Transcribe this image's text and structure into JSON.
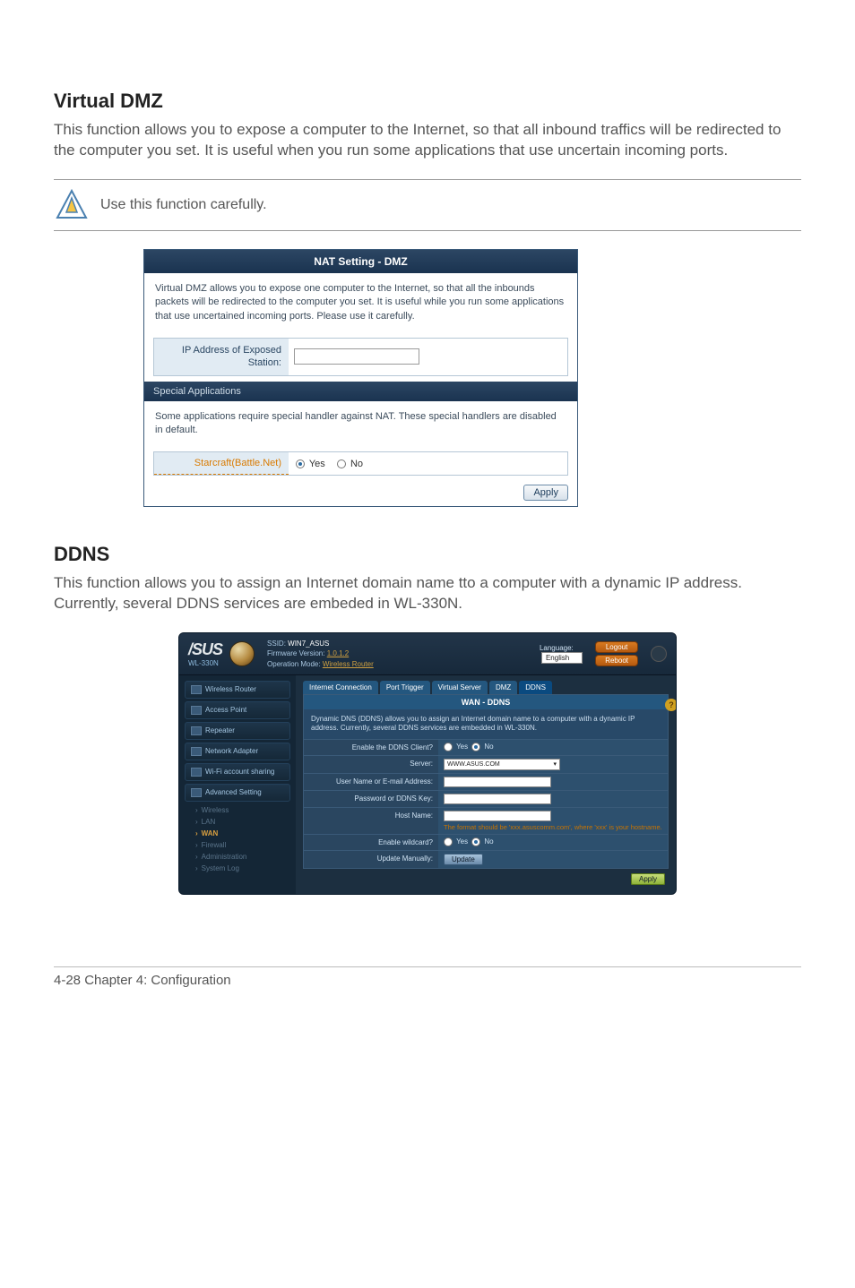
{
  "section1": {
    "heading": "Virtual DMZ",
    "desc": "This function allows you to expose a computer to the Internet, so that all inbound traffics will be redirected to the computer you set. It is useful when you run some applications that use uncertain incoming ports.",
    "note": "Use this function carefully."
  },
  "dmz": {
    "title": "NAT Setting - DMZ",
    "desc": "Virtual DMZ allows you to expose one computer to the Internet, so that all the inbounds packets will be redirected to the computer you set. It is useful while you run some applications that use uncertained incoming ports. Please use it carefully.",
    "ip_label": "IP Address of Exposed Station:",
    "ip_value": "",
    "special_header": "Special Applications",
    "special_desc": "Some applications require special handler against NAT. These special handlers are disabled in default.",
    "starcraft_label": "Starcraft(Battle.Net)",
    "yes_label": "Yes",
    "no_label": "No",
    "apply": "Apply"
  },
  "section2": {
    "heading": "DDNS",
    "desc": "This function allows you to assign an Internet domain name tto a computer with a dynamic IP address. Currently, several DDNS services are embeded in WL-330N."
  },
  "router": {
    "brand": "/SUS",
    "model": "WL-330N",
    "ssid_lbl": "SSID:",
    "ssid_val": "WIN7_ASUS",
    "fw_lbl": "Firmware Version:",
    "fw_val": "1.0.1.2",
    "mode_lbl": "Operation Mode:",
    "mode_val": "Wireless Router",
    "lang_lbl": "Language:",
    "lang_val": "English",
    "logout": "Logout",
    "reboot": "Reboot",
    "side": {
      "wireless_router": "Wireless Router",
      "access_point": "Access Point",
      "repeater": "Repeater",
      "network_adapter": "Network Adapter",
      "wifi_sharing": "Wi-Fi account sharing",
      "advanced": "Advanced Setting",
      "wireless": "Wireless",
      "lan": "LAN",
      "wan": "WAN",
      "firewall": "Firewall",
      "admin": "Administration",
      "syslog": "System Log"
    },
    "tabs": {
      "internet": "Internet Connection",
      "port_trigger": "Port Trigger",
      "virtual_server": "Virtual Server",
      "dmz": "DMZ",
      "ddns": "DDNS"
    },
    "ddns": {
      "title": "WAN - DDNS",
      "desc": "Dynamic DNS (DDNS) allows you to assign an Internet domain name to a computer with a dynamic IP address. Currently, several DDNS services are embedded in WL-330N.",
      "enable_label": "Enable the DDNS Client?",
      "server_label": "Server:",
      "server_val": "WWW.ASUS.COM",
      "user_label": "User Name or E-mail Address:",
      "pass_label": "Password or DDNS Key:",
      "host_label": "Host Name:",
      "host_hint": "The format should be 'xxx.asuscomm.com', where 'xxx' is your hostname.",
      "wildcard_label": "Enable wildcard?",
      "update_label": "Update Manually:",
      "update_btn": "Update",
      "yes": "Yes",
      "no": "No",
      "apply": "Apply"
    }
  },
  "footer": "4-28   Chapter 4: Configuration"
}
